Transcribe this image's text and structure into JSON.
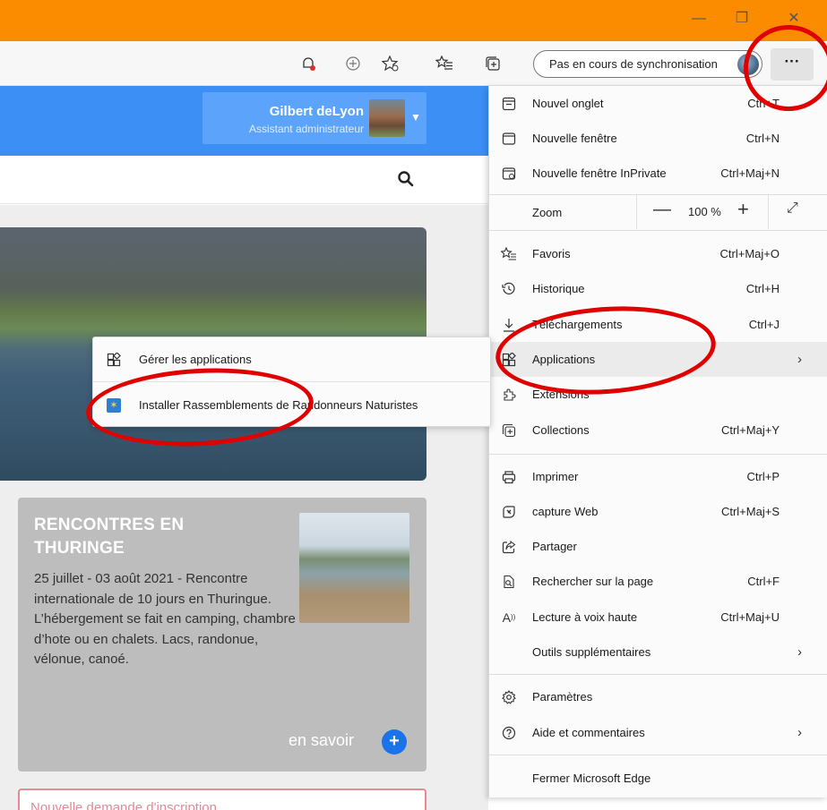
{
  "window": {
    "controls": {
      "minimize": "—",
      "restore": "❐",
      "close": "✕"
    }
  },
  "toolbar": {
    "sync_label": "Pas en cours de synchronisation",
    "more_label": "···",
    "icons": [
      "bell-icon",
      "add-tab-icon",
      "favorite-star-icon",
      "favorites-list-icon",
      "collections-icon"
    ]
  },
  "site": {
    "user": {
      "name": "Gilbert deLyon",
      "role": "Assistant administrateur"
    },
    "card": {
      "title_line1": "RENCONTRES EN",
      "title_line2": "THURINGE",
      "text": "25 juillet - 03 août 2021 - Rencontre internationale de 10 jours en Thuringue. L’hébergement se fait en camping, chambre d’hote ou en chalets. Lacs, randonue, vélonue, canoé.",
      "more": "en savoir",
      "more_plus": "+"
    },
    "pending_text": "Nouvelle demande d'inscription"
  },
  "menu": {
    "items": [
      {
        "label": "Nouvel onglet",
        "shortcut": "Ctrl+T",
        "icon": "new-tab-icon"
      },
      {
        "label": "Nouvelle fenêtre",
        "shortcut": "Ctrl+N",
        "icon": "new-window-icon"
      },
      {
        "label": "Nouvelle fenêtre InPrivate",
        "shortcut": "Ctrl+Maj+N",
        "icon": "inprivate-icon"
      }
    ],
    "zoom": {
      "label": "Zoom",
      "minus": "—",
      "value": "100 %",
      "plus": "+",
      "expand": "⤢"
    },
    "items2": [
      {
        "label": "Favoris",
        "shortcut": "Ctrl+Maj+O",
        "icon": "favorites-icon"
      },
      {
        "label": "Historique",
        "shortcut": "Ctrl+H",
        "icon": "history-icon"
      },
      {
        "label": "Téléchargements",
        "shortcut": "Ctrl+J",
        "icon": "download-icon"
      },
      {
        "label": "Applications",
        "shortcut": "",
        "icon": "apps-icon",
        "arrow": "›"
      },
      {
        "label": "Extensions",
        "shortcut": "",
        "icon": "extensions-icon"
      },
      {
        "label": "Collections",
        "shortcut": "Ctrl+Maj+Y",
        "icon": "collections-icon"
      }
    ],
    "items3": [
      {
        "label": "Imprimer",
        "shortcut": "Ctrl+P",
        "icon": "print-icon"
      },
      {
        "label": "capture Web",
        "shortcut": "Ctrl+Maj+S",
        "icon": "web-capture-icon"
      },
      {
        "label": "Partager",
        "shortcut": "",
        "icon": "share-icon"
      },
      {
        "label": "Rechercher sur la page",
        "shortcut": "Ctrl+F",
        "icon": "find-icon"
      },
      {
        "label": "Lecture à voix haute",
        "shortcut": "Ctrl+Maj+U",
        "icon": "read-aloud-icon"
      },
      {
        "label": "Outils supplémentaires",
        "shortcut": "",
        "icon": "",
        "arrow": "›"
      }
    ],
    "items4": [
      {
        "label": "Paramètres",
        "icon": "settings-icon"
      },
      {
        "label": "Aide et commentaires",
        "icon": "help-icon",
        "arrow": "›"
      },
      {
        "label": "Fermer Microsoft Edge",
        "icon": ""
      }
    ]
  },
  "submenu": {
    "manage_apps": "Gérer les applications",
    "install_app": "Installer Rassemblements de Randonneurs Naturistes"
  },
  "colors": {
    "titlebar": "#fb8c00",
    "site_header": "#3b8ff5",
    "annotation": "#e00000"
  }
}
